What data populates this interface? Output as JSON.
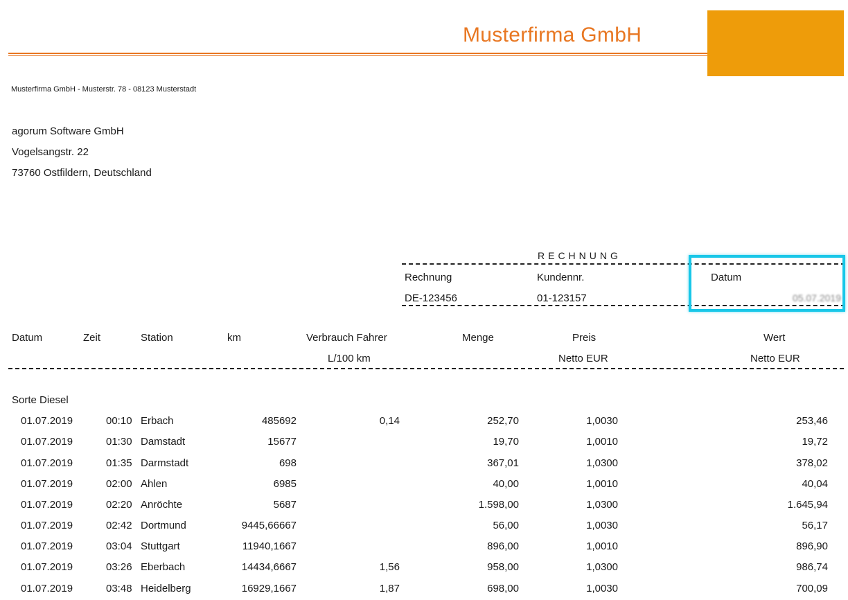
{
  "header": {
    "company_name": "Musterfirma GmbH",
    "sender_line": "Musterfirma GmbH - Musterstr. 78 - 08123 Musterstadt",
    "accent_color": "#e87722",
    "logo_color": "#ee9c0a"
  },
  "recipient": {
    "line1": "agorum Software GmbH",
    "line2": "Vogelsangstr. 22",
    "line3": "73760 Ostfildern, Deutschland"
  },
  "invoice": {
    "title": "RECHNUNG",
    "number_label": "Rechnung",
    "number_value": "DE-123456",
    "customer_label": "Kundennr.",
    "customer_value": "01-123157",
    "date_label": "Datum",
    "date_value": "05.07.2019",
    "highlight_color": "#19c7e8"
  },
  "table": {
    "headers": {
      "date": "Datum",
      "time": "Zeit",
      "station": "Station",
      "km": "km",
      "consumption": "Verbrauch Fahrer",
      "consumption_unit": "L/100 km",
      "quantity": "Menge",
      "price": "Preis",
      "price_unit": "Netto EUR",
      "value": "Wert",
      "value_unit": "Netto EUR"
    },
    "group_label": "Sorte Diesel",
    "rows": [
      {
        "date": "01.07.2019",
        "time": "00:10",
        "station": "Erbach",
        "km": "485692",
        "consumption": "0,14",
        "quantity": "252,70",
        "price": "1,0030",
        "value": "253,46"
      },
      {
        "date": "01.07.2019",
        "time": "01:30",
        "station": "Damstadt",
        "km": "15677",
        "consumption": "",
        "quantity": "19,70",
        "price": "1,0010",
        "value": "19,72"
      },
      {
        "date": "01.07.2019",
        "time": "01:35",
        "station": "Darmstadt",
        "km": "698",
        "consumption": "",
        "quantity": "367,01",
        "price": "1,0300",
        "value": "378,02"
      },
      {
        "date": "01.07.2019",
        "time": "02:00",
        "station": "Ahlen",
        "km": "6985",
        "consumption": "",
        "quantity": "40,00",
        "price": "1,0010",
        "value": "40,04"
      },
      {
        "date": "01.07.2019",
        "time": "02:20",
        "station": "Anröchte",
        "km": "5687",
        "consumption": "",
        "quantity": "1.598,00",
        "price": "1,0300",
        "value": "1.645,94"
      },
      {
        "date": "01.07.2019",
        "time": "02:42",
        "station": "Dortmund",
        "km": "9445,66667",
        "consumption": "",
        "quantity": "56,00",
        "price": "1,0030",
        "value": "56,17"
      },
      {
        "date": "01.07.2019",
        "time": "03:04",
        "station": "Stuttgart",
        "km": "11940,1667",
        "consumption": "",
        "quantity": "896,00",
        "price": "1,0010",
        "value": "896,90"
      },
      {
        "date": "01.07.2019",
        "time": "03:26",
        "station": "Eberbach",
        "km": "14434,6667",
        "consumption": "1,56",
        "quantity": "958,00",
        "price": "1,0300",
        "value": "986,74"
      },
      {
        "date": "01.07.2019",
        "time": "03:48",
        "station": "Heidelberg",
        "km": "16929,1667",
        "consumption": "1,87",
        "quantity": "698,00",
        "price": "1,0030",
        "value": "700,09"
      }
    ]
  }
}
